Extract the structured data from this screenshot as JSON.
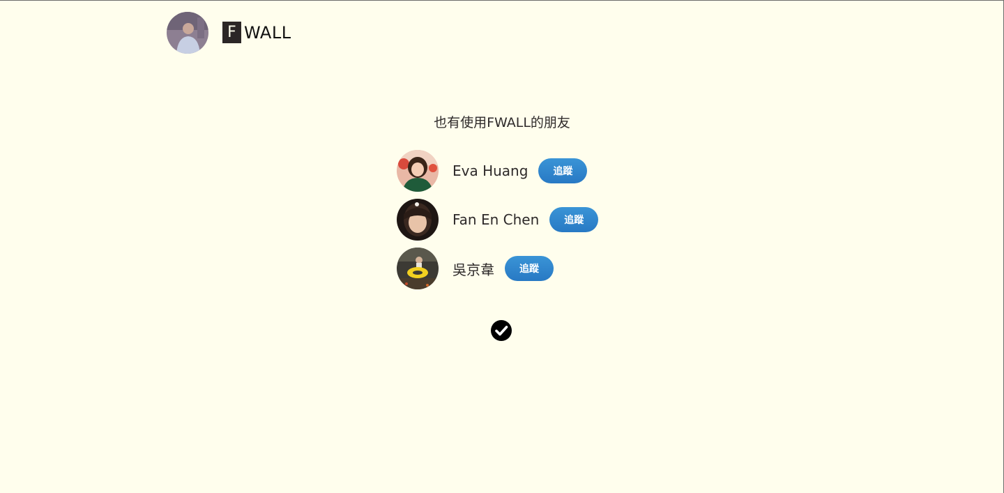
{
  "header": {
    "logo_letter": "F",
    "logo_text": "WALL"
  },
  "suggestions": {
    "title": "也有使用FWALL的朋友",
    "friends": [
      {
        "name": "Eva Huang",
        "follow_label": "追蹤"
      },
      {
        "name": "Fan En Chen",
        "follow_label": "追蹤"
      },
      {
        "name": "吳京韋",
        "follow_label": "追蹤"
      }
    ]
  },
  "done_icon": "check-circle-icon",
  "colors": {
    "background": "#fffeed",
    "button": "#2f86ca",
    "logo_box": "#2b2626"
  }
}
